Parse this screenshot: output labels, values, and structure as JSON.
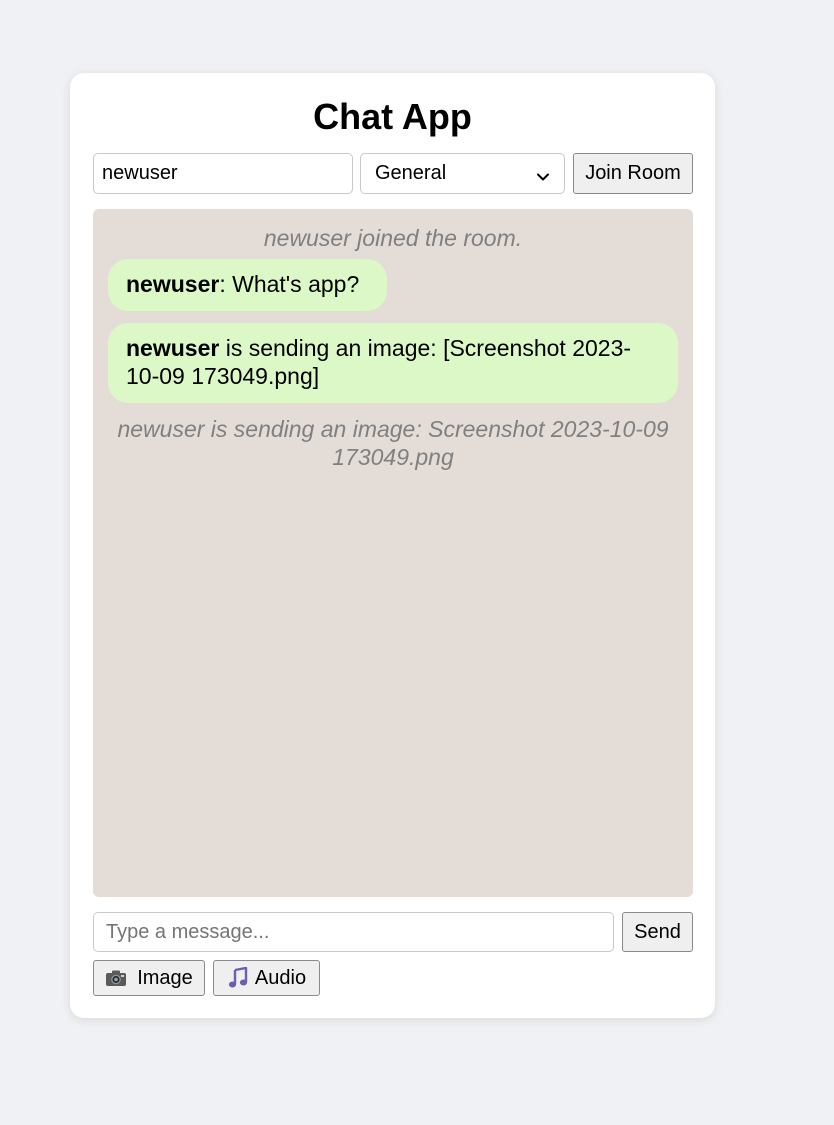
{
  "app": {
    "title": "Chat App"
  },
  "join": {
    "username_value": "newuser",
    "room_selected": "General",
    "join_label": "Join Room"
  },
  "messages": {
    "system_joined": "newuser joined the room.",
    "bubble1": {
      "user": "newuser",
      "text": ": What's app?"
    },
    "bubble2": {
      "user": "newuser",
      "text": " is sending an image: [Screenshot 2023-10-09 173049.png]"
    },
    "system_sending": "newuser is sending an image: Screenshot 2023-10-09 173049.png"
  },
  "composer": {
    "placeholder": "Type a message...",
    "send_label": "Send",
    "image_label": "Image",
    "audio_label": "Audio",
    "image_icon": "camera-icon",
    "audio_icon": "music-note-icon"
  },
  "colors": {
    "bubble": "#dcf8c6",
    "messages_bg": "#e4dcd7",
    "system_text": "#808080"
  }
}
